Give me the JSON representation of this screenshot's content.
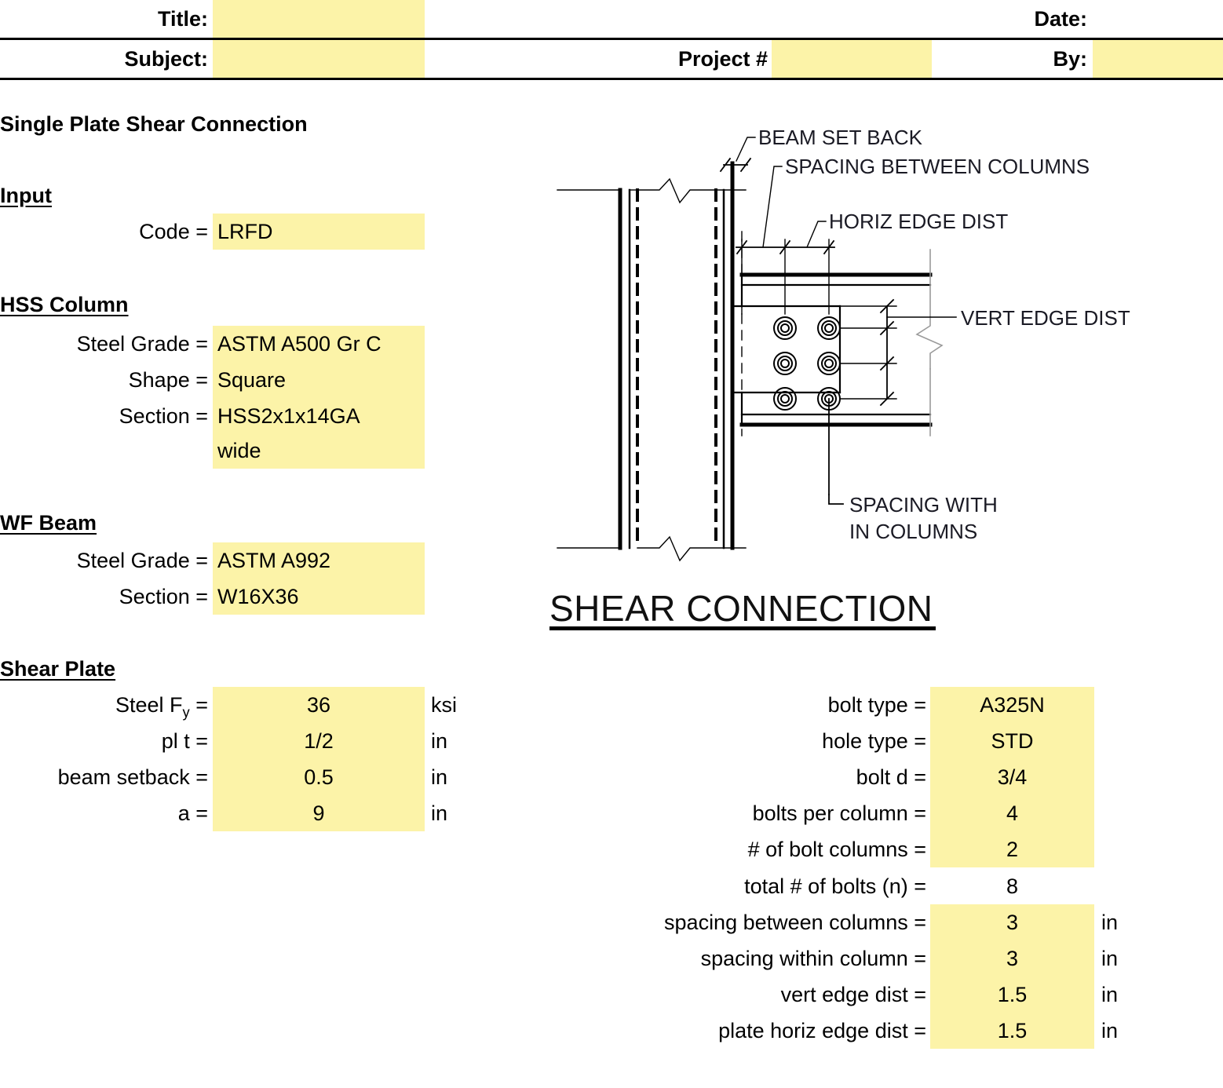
{
  "header": {
    "title_label": "Title:",
    "title_value": "",
    "date_label": "Date:",
    "date_value": "",
    "subject_label": "Subject:",
    "subject_value": "",
    "project_label": "Project #",
    "project_value": "",
    "by_label": "By:",
    "by_value": ""
  },
  "page_title": "Single Plate Shear Connection",
  "input": {
    "heading": "Input",
    "code_label": "Code =",
    "code_value": "LRFD"
  },
  "hss_column": {
    "heading": "HSS Column",
    "steel_grade_label": "Steel Grade =",
    "steel_grade_value": "ASTM A500 Gr C",
    "shape_label": "Shape =",
    "shape_value": "Square",
    "section_label": "Section =",
    "section_value": "HSS2x1x14GA",
    "section_value_line2": "wide"
  },
  "wf_beam": {
    "heading": "WF Beam",
    "steel_grade_label": "Steel Grade =",
    "steel_grade_value": "ASTM A992",
    "section_label": "Section =",
    "section_value": "W16X36"
  },
  "shear_plate": {
    "heading": "Shear Plate",
    "rows": [
      {
        "label": "Steel F",
        "sub": "y",
        "label_tail": " =",
        "value": "36",
        "unit": "ksi"
      },
      {
        "label": "pl t =",
        "value": "1/2",
        "unit": "in"
      },
      {
        "label": "beam setback =",
        "value": "0.5",
        "unit": "in"
      },
      {
        "label": "a =",
        "value": "9",
        "unit": "in"
      }
    ]
  },
  "bolts": {
    "rows": [
      {
        "label": "bolt type =",
        "value": "A325N",
        "unit": "",
        "highlight": true
      },
      {
        "label": "hole type =",
        "value": "STD",
        "unit": "",
        "highlight": true
      },
      {
        "label": "bolt d =",
        "value": "3/4",
        "unit": "",
        "highlight": true
      },
      {
        "label": "bolts per column =",
        "value": "4",
        "unit": "",
        "highlight": true
      },
      {
        "label": "# of bolt columns =",
        "value": "2",
        "unit": "",
        "highlight": true
      },
      {
        "label": "total # of bolts (n) =",
        "value": "8",
        "unit": "",
        "highlight": false
      },
      {
        "label": "spacing between columns =",
        "value": "3",
        "unit": "in",
        "highlight": true
      },
      {
        "label": "spacing within column =",
        "value": "3",
        "unit": "in",
        "highlight": true
      },
      {
        "label": "vert edge dist =",
        "value": "1.5",
        "unit": "in",
        "highlight": true
      },
      {
        "label": "plate horiz edge dist =",
        "value": "1.5",
        "unit": "in",
        "highlight": true
      }
    ]
  },
  "diagram": {
    "title": "SHEAR CONNECTION",
    "annotations": [
      "BEAM SET BACK",
      "SPACING BETWEEN COLUMNS",
      "HORIZ EDGE DIST",
      "VERT EDGE DIST",
      "SPACING WITH",
      "IN COLUMNS"
    ]
  },
  "colors": {
    "input_highlight": "#FCF3A8",
    "rule": "#000000",
    "text": "#000000"
  }
}
